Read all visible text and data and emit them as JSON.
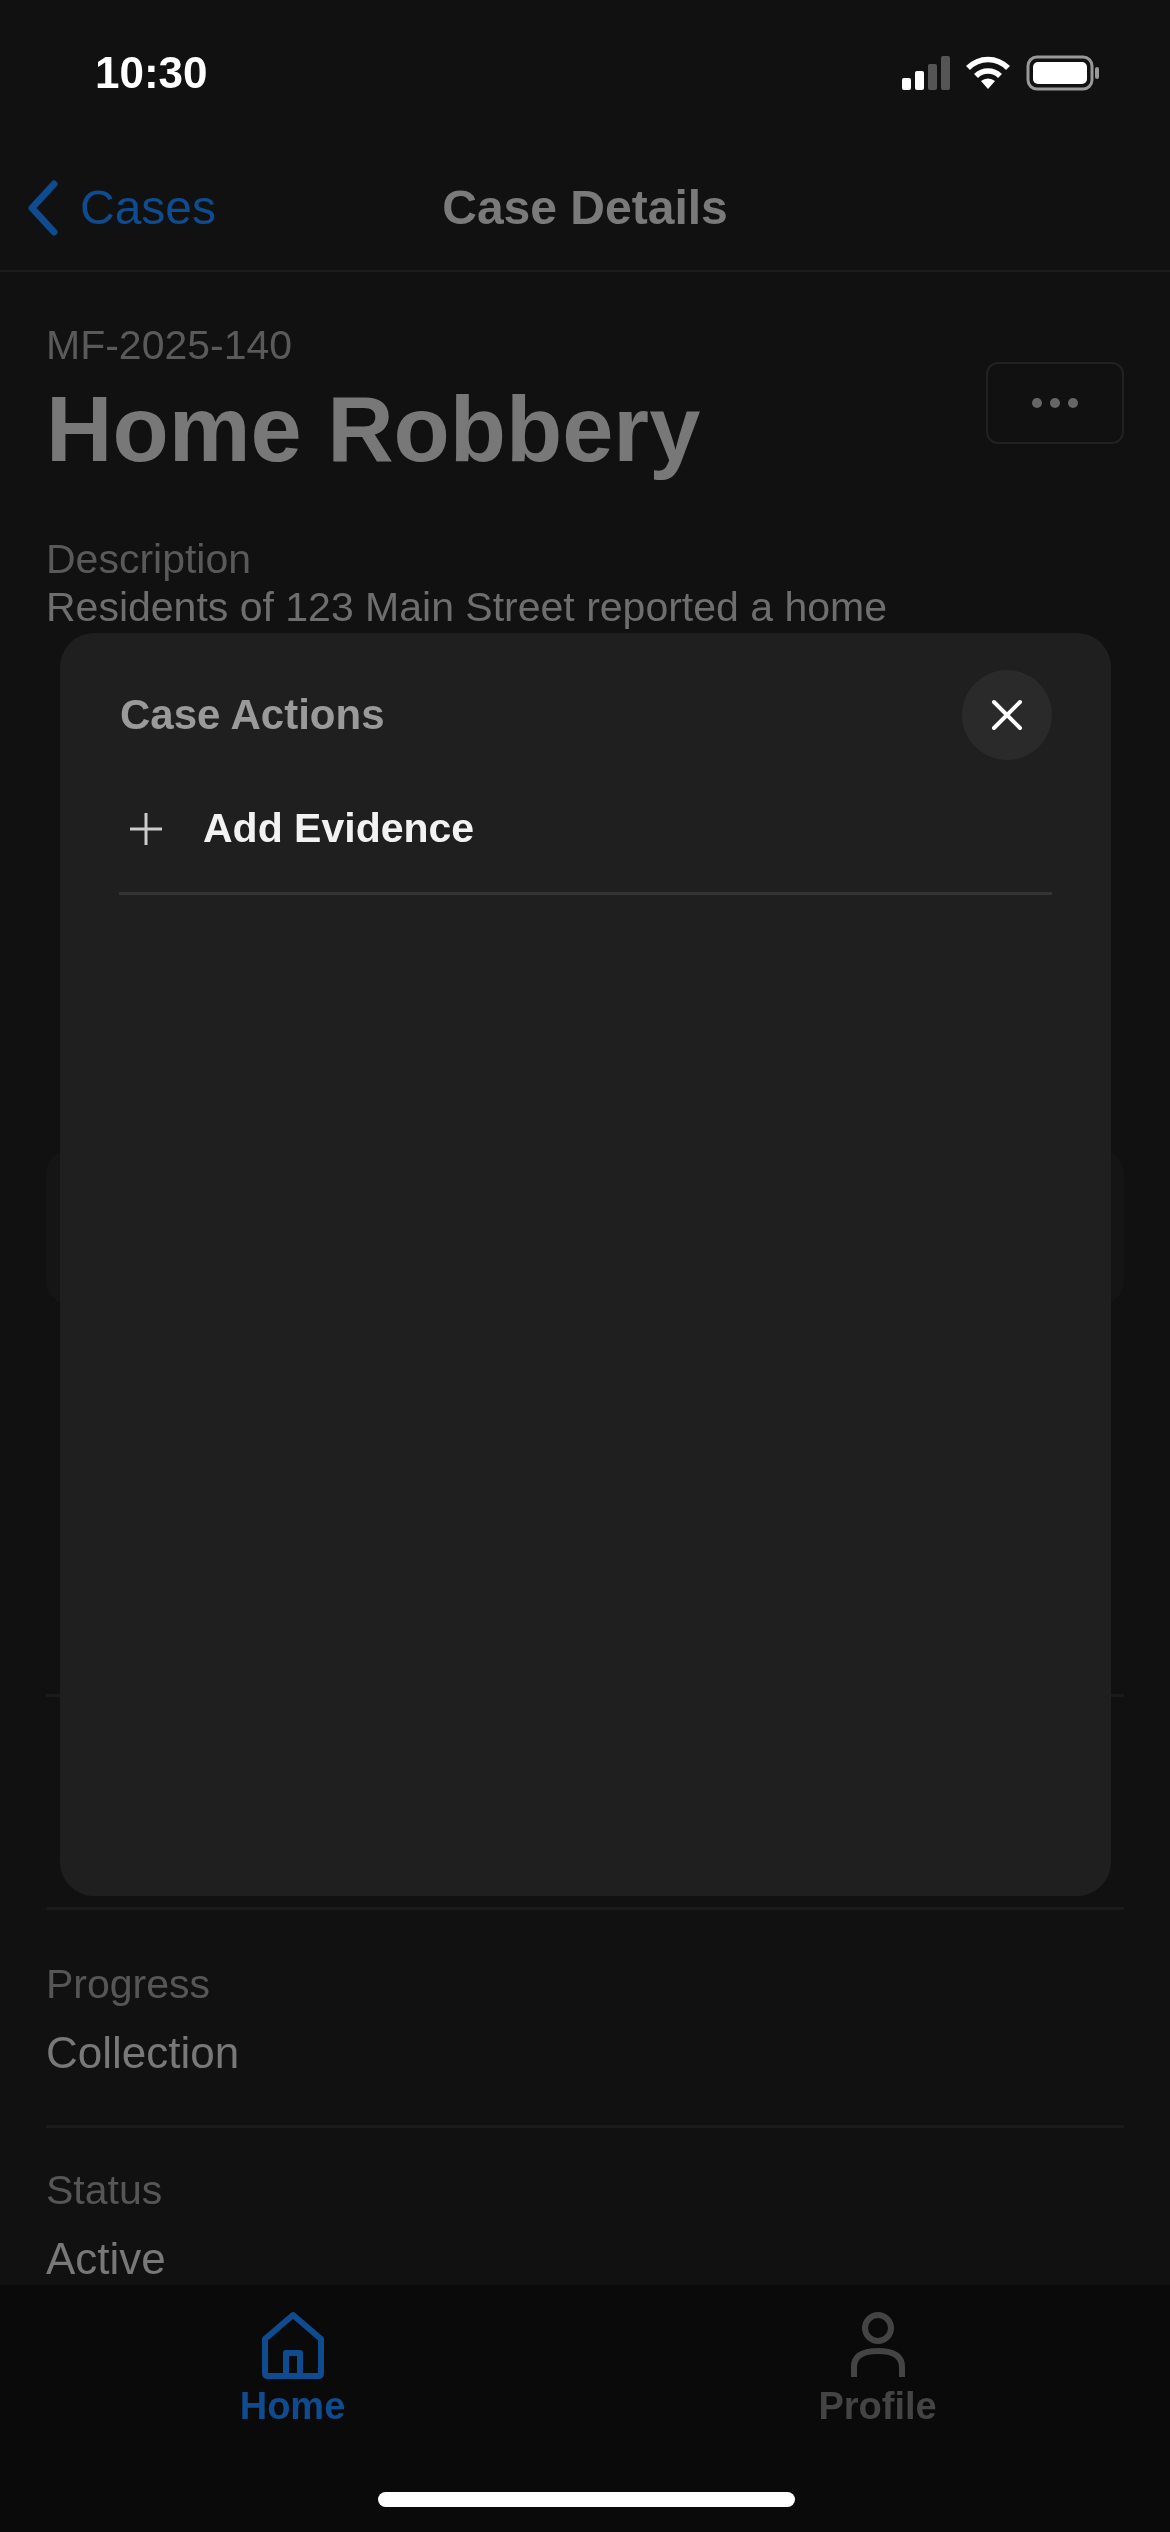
{
  "status_bar": {
    "time": "10:30"
  },
  "nav": {
    "back_label": "Cases",
    "title": "Case Details"
  },
  "case": {
    "number": "MF-2025-140",
    "title": "Home Robbery"
  },
  "description": {
    "label": "Description",
    "text": "Residents of 123 Main Street reported a home"
  },
  "details": [
    {
      "label": "Progress",
      "value": "Collection"
    },
    {
      "label": "Status",
      "value": "Active"
    }
  ],
  "modal": {
    "title": "Case Actions",
    "actions": [
      {
        "label": "Add Evidence"
      }
    ]
  },
  "tabs": [
    {
      "label": "Home",
      "kind": "home",
      "selected": true
    },
    {
      "label": "Profile",
      "kind": "person",
      "selected": false
    }
  ]
}
